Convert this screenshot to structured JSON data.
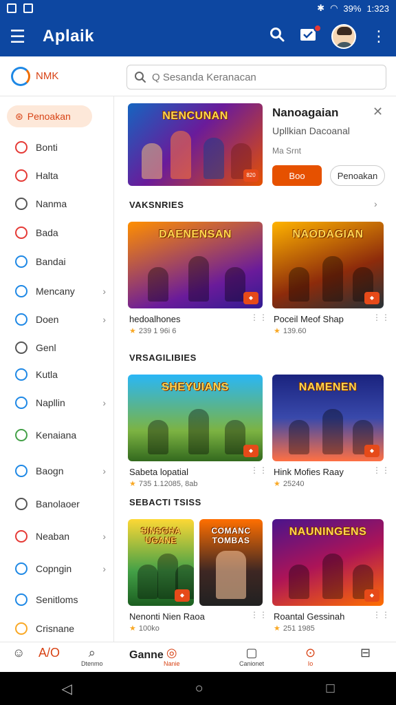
{
  "status": {
    "battery": "39%",
    "time": "1:323"
  },
  "app": {
    "title": "Aplaik"
  },
  "brand": {
    "name": "NMK"
  },
  "search": {
    "placeholder": "Q Sesanda Keranacan"
  },
  "sidebar": {
    "active": "Penoakan",
    "items": [
      {
        "label": "Bonti",
        "chevron": false
      },
      {
        "label": "Halta",
        "chevron": false
      },
      {
        "label": "Nanma",
        "chevron": false
      },
      {
        "label": "Bada",
        "chevron": false
      },
      {
        "label": "Bandai",
        "chevron": false
      },
      {
        "label": "Mencany",
        "chevron": true
      },
      {
        "label": "Doen",
        "chevron": true
      },
      {
        "label": "Genl",
        "chevron": false
      },
      {
        "label": "Kutla",
        "chevron": false
      },
      {
        "label": "Napllin",
        "chevron": true
      },
      {
        "label": "Kenaiana",
        "chevron": false
      },
      {
        "label": "Baogn",
        "chevron": true
      },
      {
        "label": "Banolaoer",
        "chevron": false
      },
      {
        "label": "Neaban",
        "chevron": true
      },
      {
        "label": "Copngin",
        "chevron": true
      },
      {
        "label": "Senitloms",
        "chevron": false
      },
      {
        "label": "Crisnane",
        "chevron": false
      }
    ]
  },
  "featured": {
    "thumb_text": "NENCUNAN",
    "title": "Nanoagaian",
    "subtitle": "Upllkian Dacoanal",
    "meta": "Ma Srnt",
    "primary_btn": "Boo",
    "secondary_btn": "Penoakan"
  },
  "sections": [
    {
      "title": "VAKSNRIES",
      "cards": [
        {
          "thumb_text": "DAENENSAN",
          "name": "hedoalhones",
          "rating": "239 1 96i 6"
        },
        {
          "thumb_text": "NAODAGIAN",
          "name": "Poceil Meof Shap",
          "rating": "139.60"
        }
      ]
    },
    {
      "title": "VRSAGILIBIES",
      "cards": [
        {
          "thumb_text": "SHEYUIANS",
          "name": "Sabeta lopatial",
          "rating": "735 1.12085, 8ab"
        },
        {
          "thumb_text": "NAMENEN",
          "name": "Hink Mofies Raay",
          "rating": "25240"
        }
      ]
    },
    {
      "title": "SEBACTI TSISS",
      "cards": [
        {
          "thumb_text": "SINSGHA UGANE",
          "thumb2_text": "COMANC TOMBAS",
          "name": "Nenonti Nien Raoa",
          "rating": "100ko"
        },
        {
          "thumb_text": "NAUNINGENS",
          "name": "Roantal Gessinah",
          "rating": "251 1985"
        }
      ]
    }
  ],
  "bottomnav": {
    "title": "Ganne",
    "items": [
      "A/O",
      "Dtenmo",
      "Nanie",
      "Canionet",
      "Io",
      ""
    ]
  }
}
